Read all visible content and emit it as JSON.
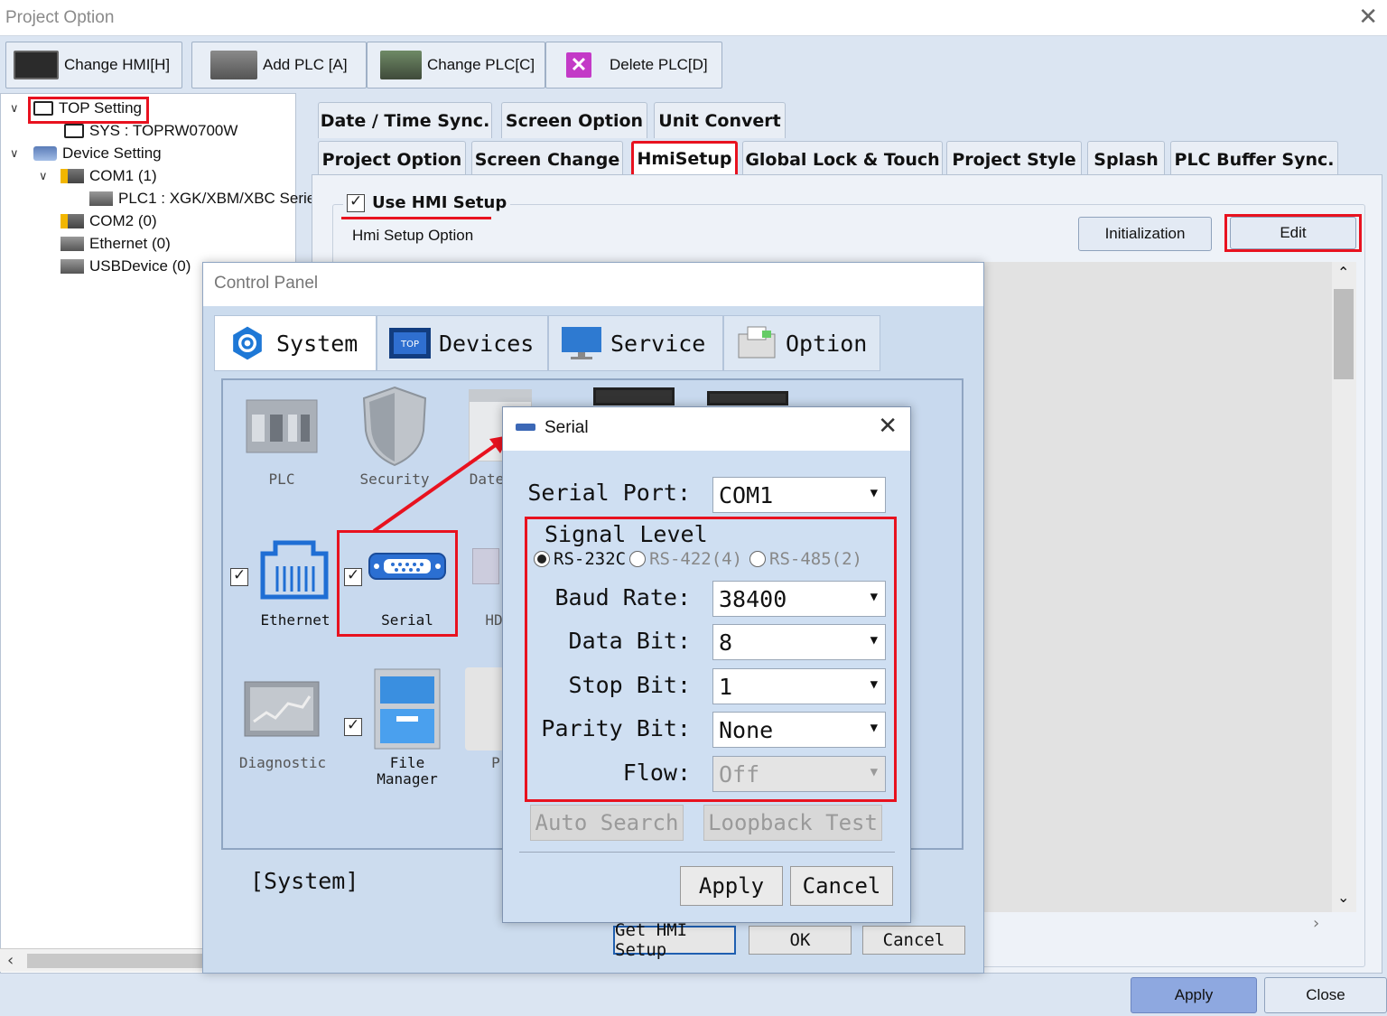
{
  "window": {
    "title": "Project Option",
    "close_glyph": "✕"
  },
  "toolbar": {
    "change_hmi": "Change HMI[H]",
    "add_plc": "Add PLC [A]",
    "change_plc": "Change PLC[C]",
    "delete_plc": "Delete PLC[D]"
  },
  "tree": {
    "top_setting": "TOP Setting",
    "sys": "SYS : TOPRW0700W",
    "device_setting": "Device Setting",
    "com1": "COM1 (1)",
    "plc1": "PLC1 : XGK/XBM/XBC Serie",
    "com2": "COM2 (0)",
    "ethernet": "Ethernet (0)",
    "usb": "USBDevice (0)"
  },
  "tabs_row1": [
    "Date / Time Sync.",
    "Screen Option",
    "Unit Convert"
  ],
  "tabs_row2": [
    "Project Option",
    "Screen Change",
    "HmiSetup",
    "Global Lock & Touch",
    "Project Style",
    "Splash",
    "PLC Buffer Sync."
  ],
  "hmi_setup": {
    "use_label": "Use HMI Setup",
    "option_label": "Hmi Setup Option",
    "initialization": "Initialization",
    "edit": "Edit"
  },
  "footer": {
    "apply": "Apply",
    "close": "Close"
  },
  "control_panel": {
    "title": "Control Panel",
    "tabs": [
      "System",
      "Devices",
      "Service",
      "Option"
    ],
    "items": {
      "plc": "PLC",
      "security": "Security",
      "date": "Date",
      "ethernet": "Ethernet",
      "serial": "Serial",
      "hd": "HD",
      "diagnostic": "Diagnostic",
      "file_manager_1": "File",
      "file_manager_2": "Manager",
      "p": "P"
    },
    "section": "[System]",
    "get_hmi_setup": "Get HMI Setup",
    "ok": "OK",
    "cancel": "Cancel"
  },
  "serial": {
    "title": "Serial",
    "serial_port_label": "Serial Port:",
    "serial_port_value": "COM1",
    "signal_level_label": "Signal Level",
    "signal_options": [
      "RS-232C",
      "RS-422(4)",
      "RS-485(2)"
    ],
    "signal_selected": "RS-232C",
    "baud_rate_label": "Baud Rate:",
    "baud_rate_value": "38400",
    "data_bit_label": "Data Bit:",
    "data_bit_value": "8",
    "stop_bit_label": "Stop Bit:",
    "stop_bit_value": "1",
    "parity_bit_label": "Parity Bit:",
    "parity_bit_value": "None",
    "flow_label": "Flow:",
    "flow_value": "Off",
    "auto_search": "Auto Search",
    "loopback_test": "Loopback Test",
    "apply": "Apply",
    "cancel": "Cancel"
  },
  "colors": {
    "highlight": "#e8121f",
    "accent": "#8ea8e0"
  }
}
